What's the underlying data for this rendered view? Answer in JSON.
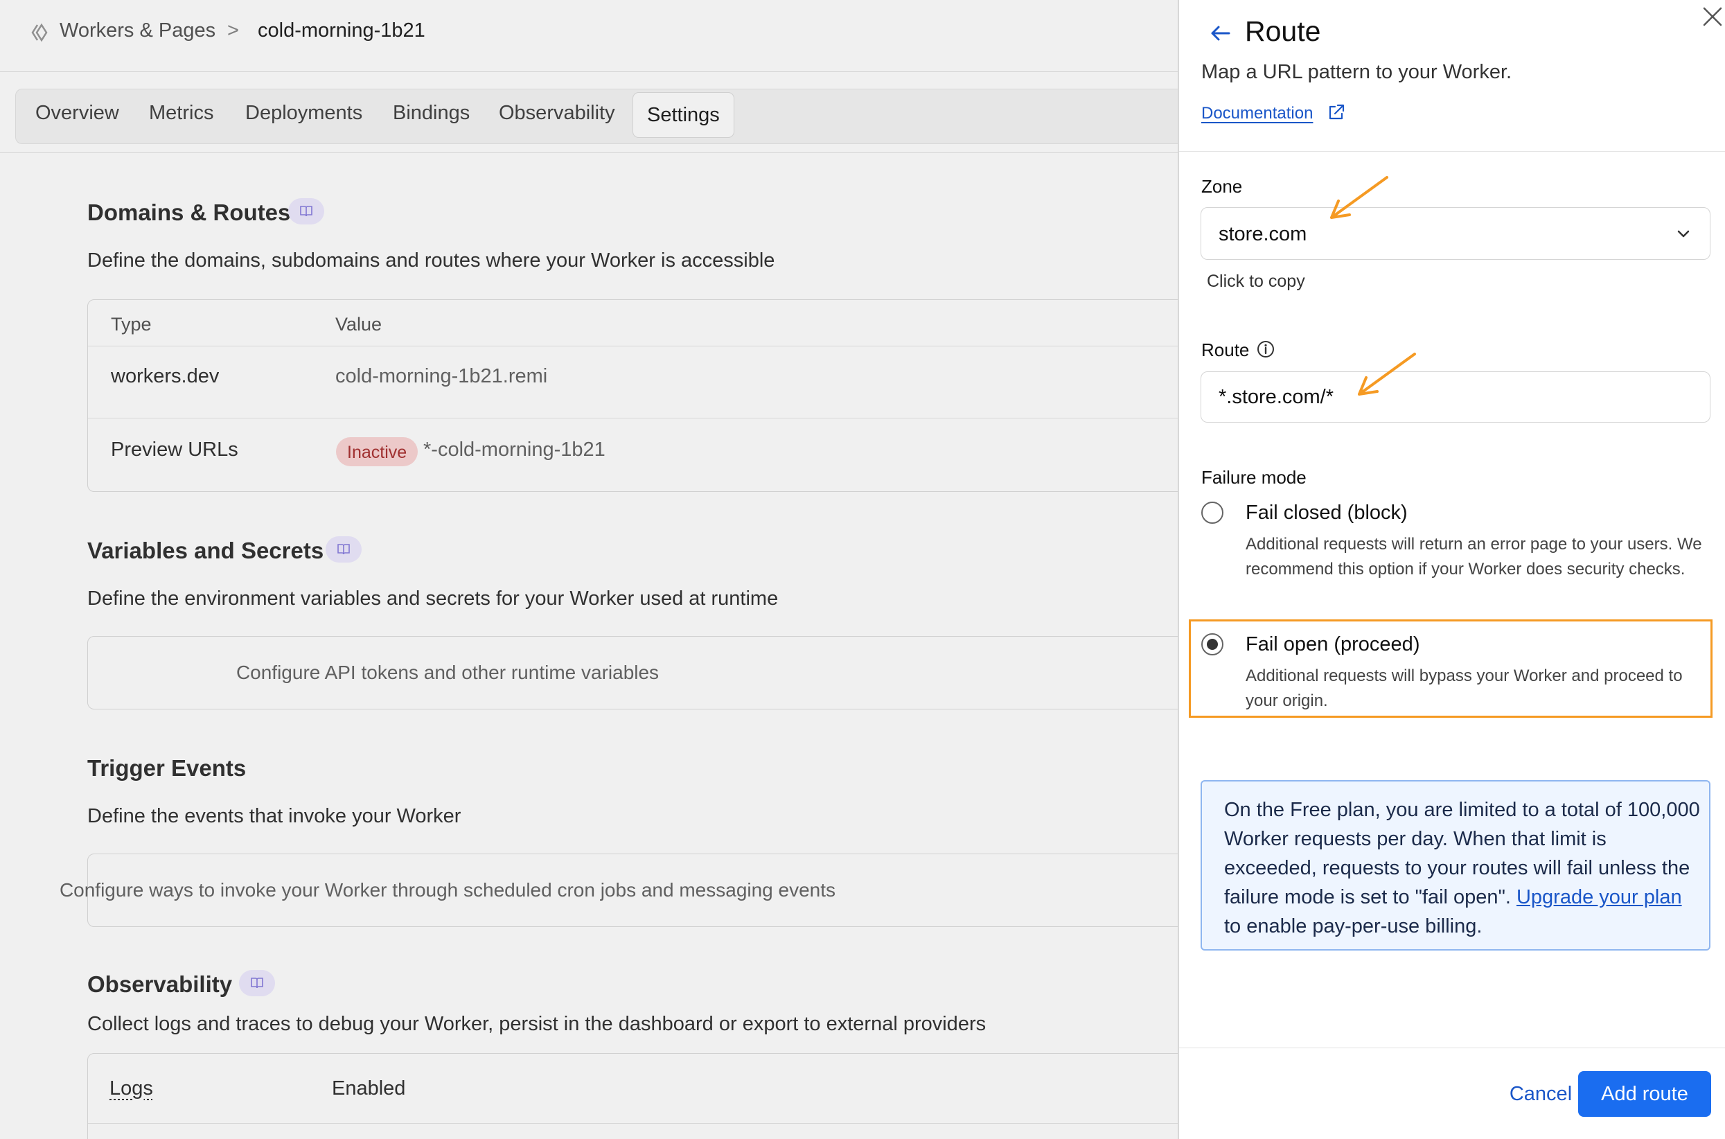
{
  "breadcrumb": {
    "root": "Workers & Pages",
    "separator": ">",
    "current": "cold-morning-1b21"
  },
  "tabs": [
    {
      "label": "Overview"
    },
    {
      "label": "Metrics"
    },
    {
      "label": "Deployments"
    },
    {
      "label": "Bindings"
    },
    {
      "label": "Observability"
    },
    {
      "label": "Settings",
      "active": true
    }
  ],
  "domains": {
    "title": "Domains & Routes",
    "description": "Define the domains, subdomains and routes where your Worker is accessible",
    "columns": [
      "Type",
      "Value"
    ],
    "rows": [
      {
        "type": "workers.dev",
        "value": "cold-morning-1b21.remi"
      },
      {
        "type": "Preview URLs",
        "badge": "Inactive",
        "value": "*-cold-morning-1b21"
      }
    ]
  },
  "variables": {
    "title": "Variables and Secrets",
    "description": "Define the environment variables and secrets for your Worker used at runtime",
    "empty": "Configure API tokens and other runtime variables"
  },
  "triggers": {
    "title": "Trigger Events",
    "description": "Define the events that invoke your Worker",
    "empty": "Configure ways to invoke your Worker through scheduled cron jobs and messaging events"
  },
  "observability": {
    "title": "Observability",
    "description": "Collect logs and traces to debug your Worker, persist in the dashboard or export to external providers",
    "row_label": "Logs",
    "row_value": "Enabled"
  },
  "panel": {
    "title": "Route",
    "subtitle": "Map a URL pattern to your Worker.",
    "doc_link": "Documentation",
    "zone": {
      "label": "Zone",
      "value": "store.com",
      "hint": "Click to copy"
    },
    "route": {
      "label": "Route",
      "value": "*.store.com/*"
    },
    "failure_mode": {
      "label": "Failure mode",
      "options": [
        {
          "label": "Fail closed (block)",
          "description": "Additional requests will return an error page to your users. We recommend this option if your Worker does security checks.",
          "checked": false
        },
        {
          "label": "Fail open (proceed)",
          "description": "Additional requests will bypass your Worker and proceed to your origin.",
          "checked": true
        }
      ]
    },
    "notice": {
      "text_before": "On the Free plan, you are limited to a total of 100,000 Worker requests per day. When that limit is exceeded, requests to your routes will fail unless the failure mode is set to \"fail open\". ",
      "link": "Upgrade your plan",
      "text_after": " to enable pay-per-use billing."
    },
    "cancel_label": "Cancel",
    "submit_label": "Add route"
  },
  "colors": {
    "accent": "#1a6df0",
    "highlight": "#f59a23",
    "badge_bg": "#fbd6d6"
  }
}
